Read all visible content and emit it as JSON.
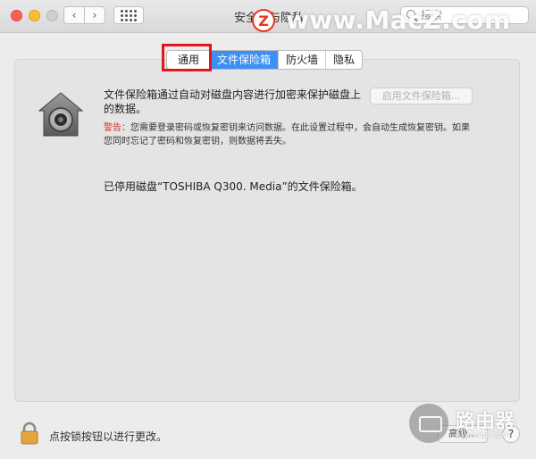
{
  "window": {
    "title": "安全性与隐私",
    "search_placeholder": "搜索"
  },
  "watermark": {
    "logo_letter": "Z",
    "site": "www.MacZ.com",
    "corner_text": "路由器",
    "corner_sub": "luyouqi.com"
  },
  "tabs": [
    {
      "label": "通用"
    },
    {
      "label": "文件保险箱"
    },
    {
      "label": "防火墙"
    },
    {
      "label": "隐私"
    }
  ],
  "filevault": {
    "description": "文件保险箱通过自动对磁盘内容进行加密来保护磁盘上的数据。",
    "enable_button": "启用文件保险箱...",
    "warning_label": "警告：",
    "warning_text": "您需要登录密码或恢复密钥来访问数据。在此设置过程中，会自动生成恢复密钥。如果您同时忘记了密码和恢复密钥，则数据将丢失。",
    "status": "已停用磁盘“TOSHIBA Q300. Media”的文件保险箱。"
  },
  "footer": {
    "lock_text": "点按锁按钮以进行更改。",
    "advanced_button": "高级...",
    "help_button": "?"
  },
  "colors": {
    "accent": "#3c8ff5",
    "highlight_box": "#e2161d",
    "warning": "#d0312d"
  }
}
